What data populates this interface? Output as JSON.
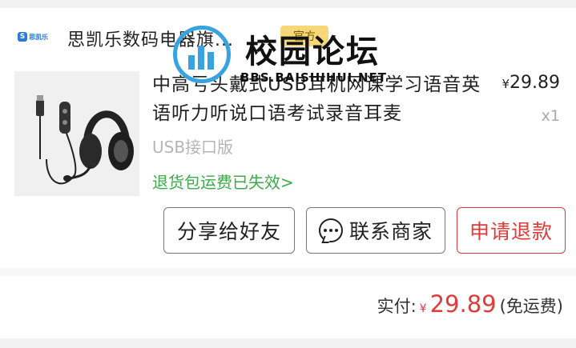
{
  "store": {
    "logo_text": "思凯乐",
    "name": "思凯乐数码电器旗...",
    "tag": "官方"
  },
  "watermark": {
    "title": "校园论坛",
    "subtitle": "BBS.BAISHIHUI.NET"
  },
  "product": {
    "title": "中高亏头戴式USB耳机网课学习语音英语听力听说口语考试录音耳麦",
    "variant": "USB接口版",
    "return_notice": "退货包运费已失效>",
    "price_currency": "¥",
    "price": "29.89",
    "quantity": "x1"
  },
  "actions": {
    "share": "分享给好友",
    "contact": "联系商家",
    "refund": "申请退款"
  },
  "summary": {
    "label": "实付:",
    "currency": "¥",
    "amount": "29.89",
    "shipping_note": "(免运费)"
  },
  "colors": {
    "accent_red": "#e13a3a",
    "notice_green": "#3aaa4a",
    "tag_yellow": "#f6d87a"
  }
}
